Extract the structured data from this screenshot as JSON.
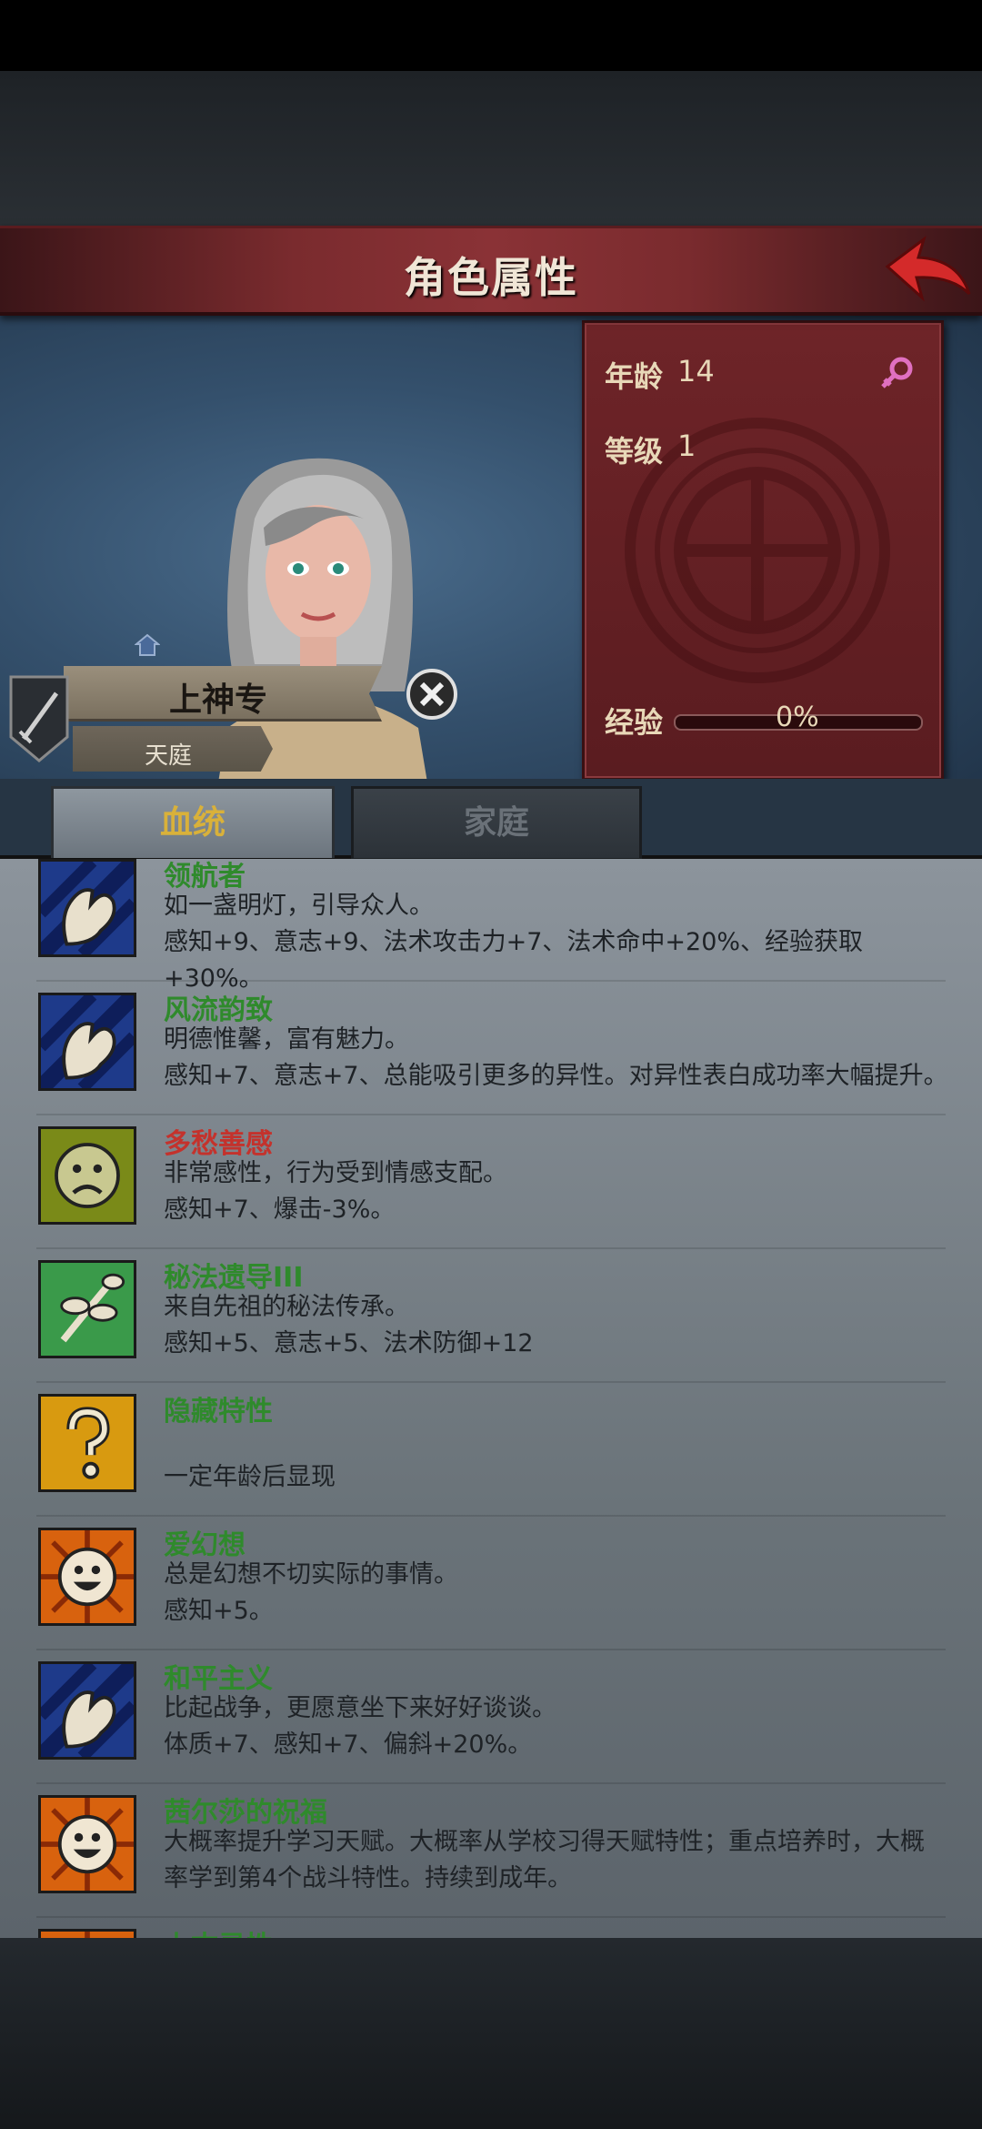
{
  "header": {
    "title": "角色属性"
  },
  "stats": {
    "age_label": "年龄",
    "age_value": "14",
    "level_label": "等级",
    "level_value": "1",
    "exp_label": "经验",
    "exp_value": "0%",
    "exp_fraction": 0
  },
  "character": {
    "name": "上神专",
    "origin": "天庭"
  },
  "tabs": [
    {
      "label": "血统",
      "active": true
    },
    {
      "label": "家庭",
      "active": false
    }
  ],
  "traits": [
    {
      "name": "领航者",
      "color": "green",
      "icon": "arm-icon",
      "desc1": "如一盏明灯，引导众人。",
      "desc2": "感知+9、意志+9、法术攻击力+7、法术命中+20%、经验获取",
      "desc3": "+30%。"
    },
    {
      "name": "风流韵致",
      "color": "green",
      "icon": "arm-icon",
      "desc1": "明德惟馨，富有魅力。",
      "desc2": "感知+7、意志+7、总能吸引更多的异性。对异性表白成功率大幅提升。",
      "desc3": ""
    },
    {
      "name": "多愁善感",
      "color": "red",
      "icon": "sad-face-icon",
      "desc1": "非常感性，行为受到情感支配。",
      "desc2": "感知+7、爆击-3%。",
      "desc3": ""
    },
    {
      "name": "秘法遗导III",
      "color": "green",
      "icon": "branch-icon",
      "desc1": "来自先祖的秘法传承。",
      "desc2": "感知+5、意志+5、法术防御+12",
      "desc3": ""
    },
    {
      "name": "隐藏特性",
      "color": "green",
      "icon": "question-icon",
      "desc1": "",
      "desc2": "一定年龄后显现",
      "desc3": ""
    },
    {
      "name": "爱幻想",
      "color": "green",
      "icon": "sun-face-icon",
      "desc1": "总是幻想不切实际的事情。",
      "desc2": "感知+5。",
      "desc3": ""
    },
    {
      "name": "和平主义",
      "color": "green",
      "icon": "arm-icon",
      "desc1": "比起战争，更愿意坐下来好好谈谈。",
      "desc2": "体质+7、感知+7、偏斜+20%。",
      "desc3": ""
    },
    {
      "name": "茜尔莎的祝福",
      "color": "green",
      "icon": "sun-face-icon",
      "desc1": "大概率提升学习天赋。大概率从学校习得天赋特性；重点培养时，大概",
      "desc2": "率学到第4个战斗特性。持续到成年。",
      "desc3": ""
    },
    {
      "name": "上古灵性",
      "color": "green",
      "icon": "sun-face-icon",
      "desc1": "",
      "desc2": "",
      "desc3": ""
    }
  ]
}
